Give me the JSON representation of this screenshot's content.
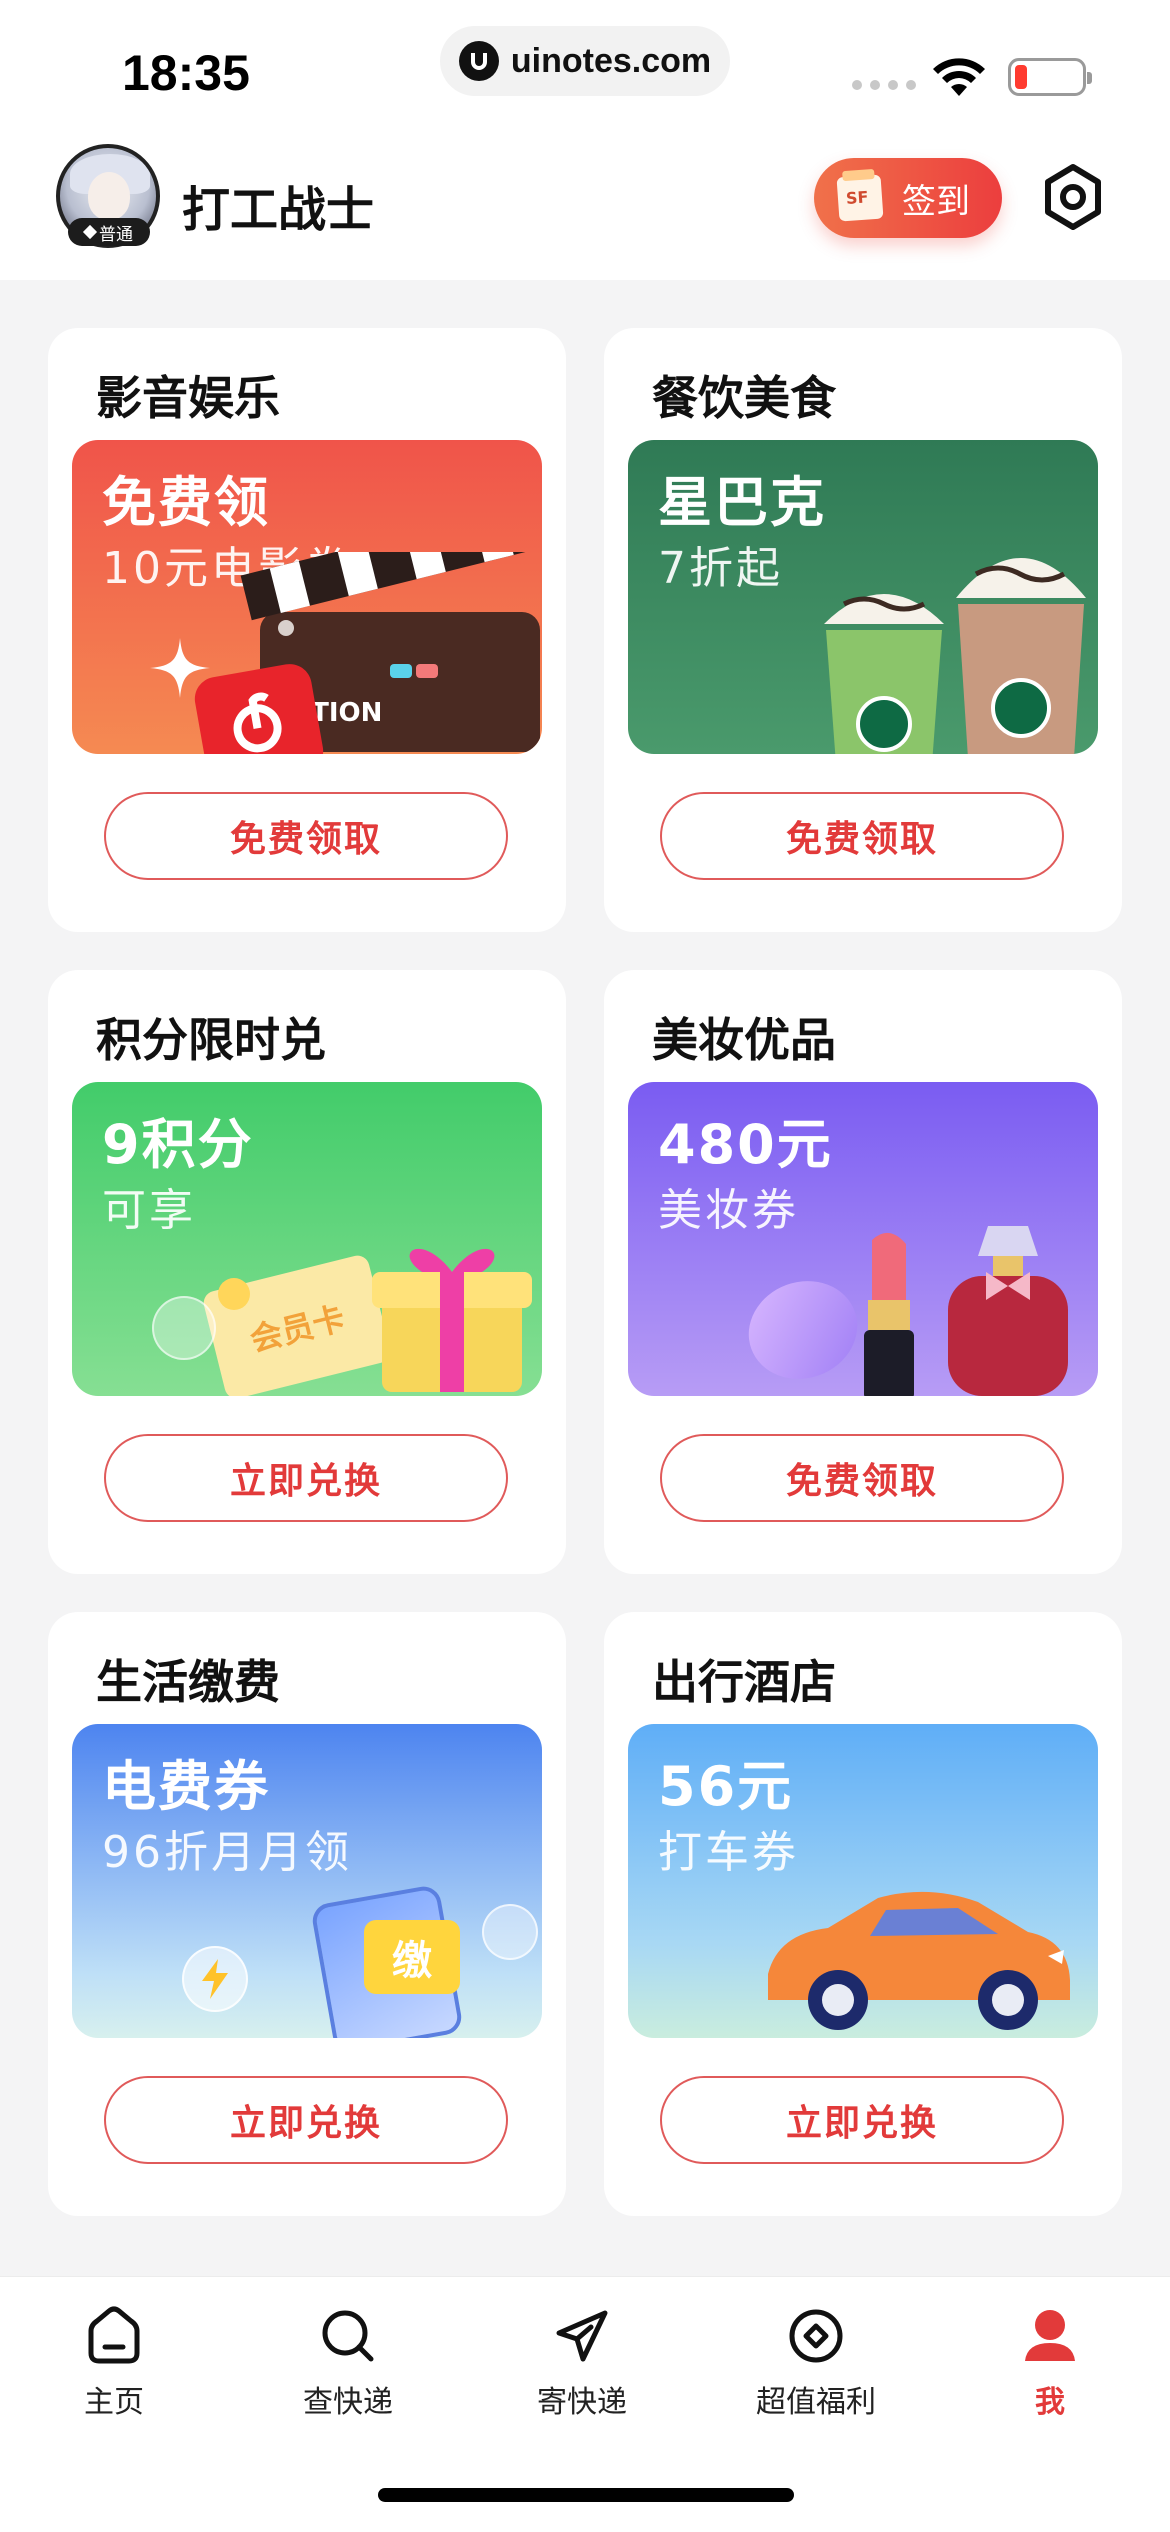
{
  "status_bar": {
    "time": "18:35",
    "url": "uinotes.com",
    "battery_level": 0.15
  },
  "header": {
    "username": "打工战士",
    "level_badge": "普通",
    "checkin_label": "签到",
    "checkin_icon_text": "SF",
    "settings_icon": "settings-icon"
  },
  "cards": [
    {
      "title": "影音娱乐",
      "headline": "免费领",
      "sub": "10元电影券",
      "button": "免费领取",
      "banner_text": "CTION",
      "accent": "#f0544a"
    },
    {
      "title": "餐饮美食",
      "headline": "星巴克",
      "sub": "7折起",
      "button": "免费领取",
      "accent": "#2f7a55"
    },
    {
      "title": "积分限时兑",
      "headline": "9积分",
      "sub": "可享",
      "button": "立即兑换",
      "banner_text": "会员卡",
      "accent": "#42cc6a"
    },
    {
      "title": "美妆优品",
      "headline": "480元",
      "sub": "美妆券",
      "button": "免费领取",
      "accent": "#7a5cf2"
    },
    {
      "title": "生活缴费",
      "headline": "电费券",
      "sub": "96折月月领",
      "button": "立即兑换",
      "banner_text": "缴",
      "accent": "#4d84f0"
    },
    {
      "title": "出行酒店",
      "headline": "56元",
      "sub": "打车券",
      "button": "立即兑换",
      "accent": "#5faef7"
    }
  ],
  "tabbar": {
    "items": [
      {
        "label": "主页",
        "icon": "home-icon"
      },
      {
        "label": "查快递",
        "icon": "search-icon"
      },
      {
        "label": "寄快递",
        "icon": "send-icon"
      },
      {
        "label": "超值福利",
        "icon": "target-icon"
      },
      {
        "label": "我",
        "icon": "profile-icon",
        "active": true
      }
    ],
    "active_color": "#e23a3a"
  },
  "colors": {
    "primary_red": "#e23a3a",
    "page_bg": "#f4f4f5"
  }
}
